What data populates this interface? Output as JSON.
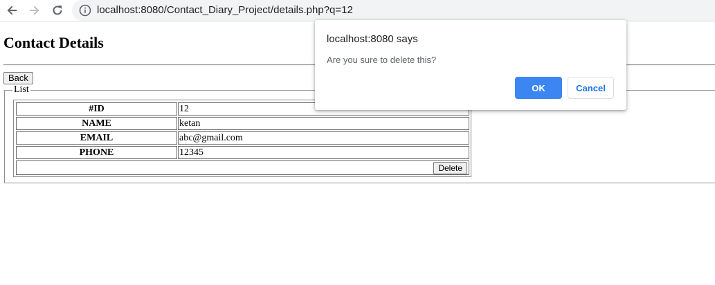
{
  "browser": {
    "url": "localhost:8080/Contact_Diary_Project/details.php?q=12"
  },
  "page": {
    "title": "Contact Details",
    "back_label": "Back",
    "legend": "List",
    "rows": [
      {
        "key": "#ID",
        "value": "12"
      },
      {
        "key": "NAME",
        "value": "ketan"
      },
      {
        "key": "EMAIL",
        "value": "abc@gmail.com"
      },
      {
        "key": "PHONE",
        "value": "12345"
      }
    ],
    "delete_label": "Delete"
  },
  "dialog": {
    "origin": "localhost:8080 says",
    "message": "Are you sure to delete this?",
    "ok_label": "OK",
    "cancel_label": "Cancel"
  },
  "colors": {
    "ok_button": "#3b86f0",
    "cancel_text": "#1a73e8",
    "omnibox": "#f1f3f4"
  },
  "icons": {
    "back": "arrow-left-icon",
    "forward": "arrow-right-icon",
    "reload": "reload-icon",
    "info": "info-icon"
  }
}
